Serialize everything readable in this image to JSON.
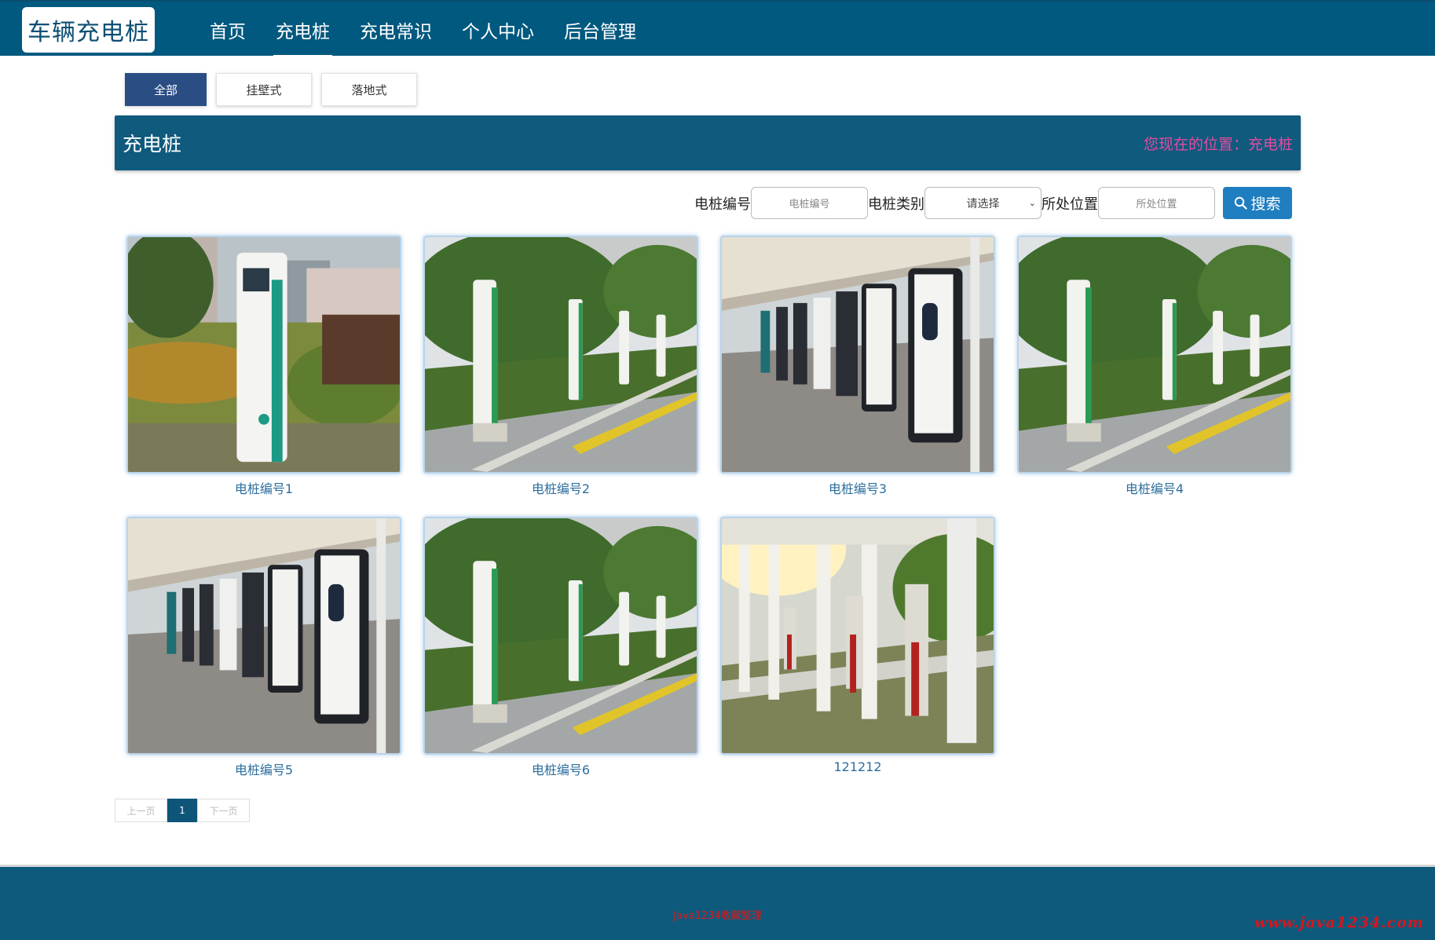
{
  "header": {
    "logo": "车辆充电桩",
    "nav": [
      "首页",
      "充电桩",
      "充电常识",
      "个人中心",
      "后台管理"
    ]
  },
  "filters": [
    "全部",
    "挂壁式",
    "落地式"
  ],
  "section": {
    "title": "充电桩",
    "breadcrumb": "您现在的位置：充电桩"
  },
  "search": {
    "label_number": "电桩编号",
    "placeholder_number": "电桩编号",
    "label_type": "电桩类别",
    "select_value": "请选择",
    "label_location": "所处位置",
    "placeholder_location": "所处位置",
    "button": "搜索"
  },
  "items": [
    {
      "caption": "电桩编号1",
      "scene": "single"
    },
    {
      "caption": "电桩编号2",
      "scene": "row-green"
    },
    {
      "caption": "电桩编号3",
      "scene": "canopy"
    },
    {
      "caption": "电桩编号4",
      "scene": "row-green"
    },
    {
      "caption": "电桩编号5",
      "scene": "canopy"
    },
    {
      "caption": "电桩编号6",
      "scene": "row-green"
    },
    {
      "caption": "121212",
      "scene": "pavilion"
    }
  ],
  "pagination": {
    "prev": "上一页",
    "current": "1",
    "next": "下一页"
  },
  "footer": {
    "text": "Java1234收藏整理",
    "watermark": "www.java1234.com"
  },
  "colors": {
    "header_bg": "#02597f",
    "accent": "#1f7ec0",
    "breadcrumb": "#e64aa0"
  }
}
